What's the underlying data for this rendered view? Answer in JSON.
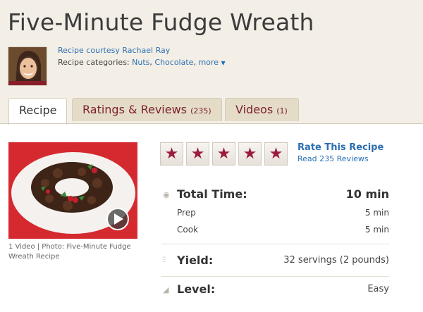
{
  "recipe": {
    "title": "Five-Minute Fudge Wreath",
    "courtesy": "Recipe courtesy Rachael Ray",
    "categories_prefix": "Recipe categories:",
    "categories": [
      "Nuts",
      "Chocolate"
    ],
    "more_label": "more",
    "more_icon": "chevron-down-icon"
  },
  "tabs": [
    {
      "label": "Recipe",
      "count": ""
    },
    {
      "label": "Ratings & Reviews",
      "count": "(235)"
    },
    {
      "label": "Videos",
      "count": "(1)"
    }
  ],
  "media": {
    "caption": "1 Video | Photo: Five-Minute Fudge Wreath Recipe",
    "play_icon": "play-icon"
  },
  "rating": {
    "stars": 5,
    "rate_label": "Rate This Recipe",
    "reviews_label": "Read 235 Reviews",
    "star_color": "#9c1b3a"
  },
  "details": {
    "total_time_label": "Total Time:",
    "total_time_value": "10 min",
    "prep_label": "Prep",
    "prep_value": "5 min",
    "cook_label": "Cook",
    "cook_value": "5 min",
    "yield_label": "Yield:",
    "yield_value": "32 servings (2 pounds)",
    "level_label": "Level:",
    "level_value": "Easy"
  },
  "colors": {
    "header_bg": "#f3efe6",
    "link": "#2b6fb3",
    "tab_inactive_bg": "#e5dcc7",
    "tab_text": "#7a1f2f"
  }
}
